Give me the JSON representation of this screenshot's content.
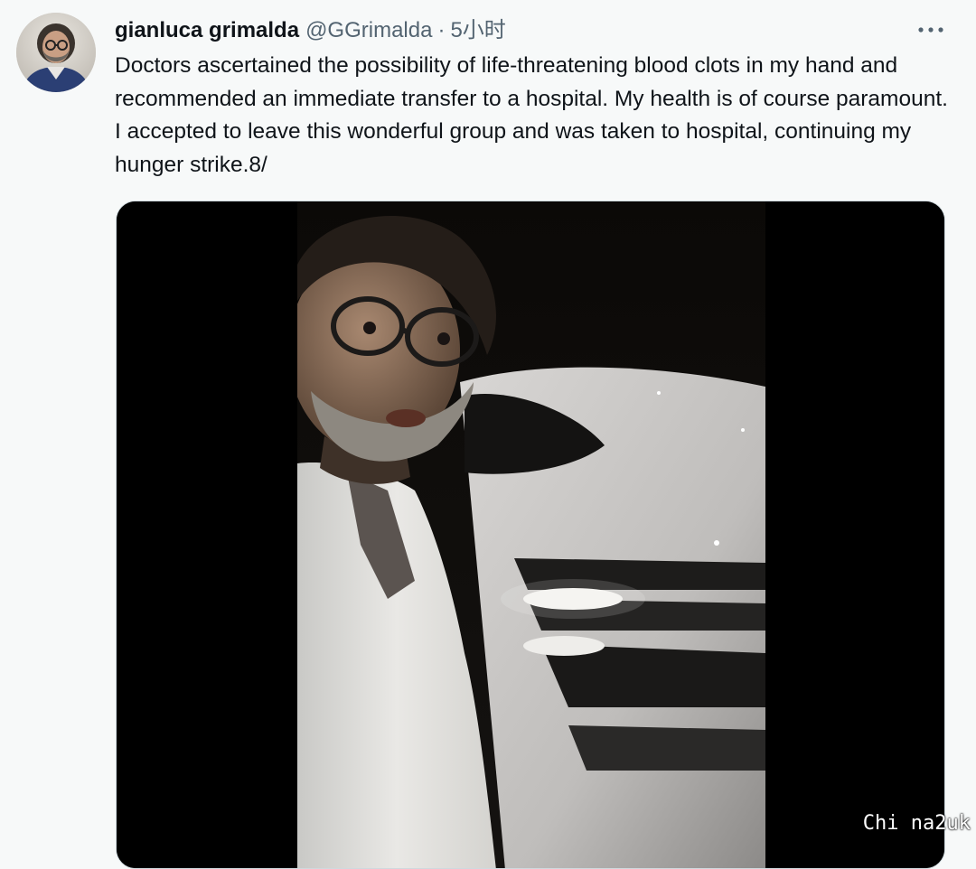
{
  "tweet": {
    "display_name": "gianluca grimalda",
    "handle": "@GGrimalda",
    "separator": "·",
    "time": "5小时",
    "more_icon": "more-horizontal-icon",
    "text": "Doctors ascertained the possibility of life-threatening blood clots in my hand and recommended an immediate transfer to a hospital. My health is of course paramount. I accepted to leave this wonderful group and was taken to hospital, continuing my hunger strike.8/"
  },
  "watermark": {
    "text": "Chi na2uk"
  },
  "colors": {
    "background": "#f7f9f9",
    "text_primary": "#0f1419",
    "text_secondary": "#536471",
    "media_background": "#000000"
  }
}
